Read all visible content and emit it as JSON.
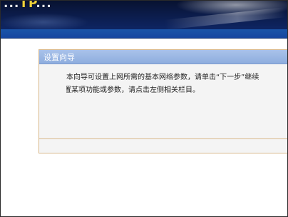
{
  "banner": {
    "text_parts": [
      "...",
      "TP",
      "..."
    ],
    "accent_color": "#f0d23a",
    "bar_color": "#1a55a8"
  },
  "wizard": {
    "title": "设置向导",
    "desc_line1": "本向导可设置上网所需的基本网络参数，请单击“下一步”继续",
    "desc_line2": "置某项功能或参数，请点击左侧相关栏目。",
    "header_color": "#8eadde",
    "border_color": "#d9b98c"
  }
}
